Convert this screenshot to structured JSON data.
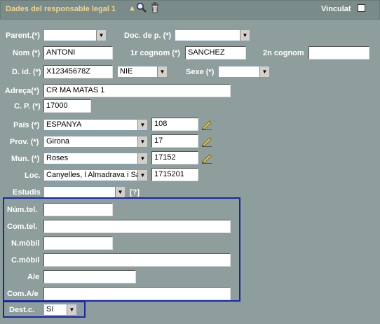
{
  "header": {
    "title": "Dades del responsable legal 1",
    "title_arrow": "▲",
    "vinculat_label": "Vinculat"
  },
  "rows": {
    "parent": {
      "label": "Parent.(*)",
      "value": ""
    },
    "doc_type": {
      "label": "Doc. de p. (*)",
      "value": ""
    },
    "nom": {
      "label": "Nom (*)",
      "value": "ANTONI"
    },
    "cognom1": {
      "label": "1r cognom (*)",
      "value": "SANCHEZ"
    },
    "cognom2": {
      "label": "2n cognom",
      "value": ""
    },
    "did": {
      "label": "D. id. (*)",
      "value": "X12345678Z",
      "type_value": "NIE"
    },
    "sexe": {
      "label": "Sexe (*)",
      "value": ""
    },
    "adreca": {
      "label": "Adreça(*)",
      "value": "CR MA MATAS 1"
    },
    "cp": {
      "label": "C. P. (*)",
      "value": "17000"
    },
    "pais": {
      "label": "País (*)",
      "value": "ESPANYA",
      "code": "108"
    },
    "prov": {
      "label": "Prov. (*)",
      "value": "Girona",
      "code": "17"
    },
    "mun": {
      "label": "Mun. (*)",
      "value": "Roses",
      "code": "17152"
    },
    "loc": {
      "label": "Loc.",
      "value": "Canyelles, l Almadrava i Sant",
      "code": "1715201"
    },
    "estudis": {
      "label": "Estudis",
      "value": "",
      "help": "[?]"
    },
    "num_tel": {
      "label": "Núm.tel.",
      "value": ""
    },
    "com_tel": {
      "label": "Com.tel.",
      "value": ""
    },
    "n_mobil": {
      "label": "N.mòbil",
      "value": ""
    },
    "c_mobil": {
      "label": "C.mòbil",
      "value": ""
    },
    "ae": {
      "label": "A/e",
      "value": ""
    },
    "com_ae": {
      "label": "Com.A/e",
      "value": ""
    },
    "dest": {
      "label": "Dest.c.",
      "value": "Sí"
    }
  },
  "icons": {
    "search": "magnifier-icon",
    "delete": "trash-icon",
    "edit": "pencil-icon",
    "dropdown": "chevron-down-icon"
  },
  "colors": {
    "background": "#8e9e9c",
    "title": "#f3d58a",
    "highlight_box": "#1a27a6"
  }
}
